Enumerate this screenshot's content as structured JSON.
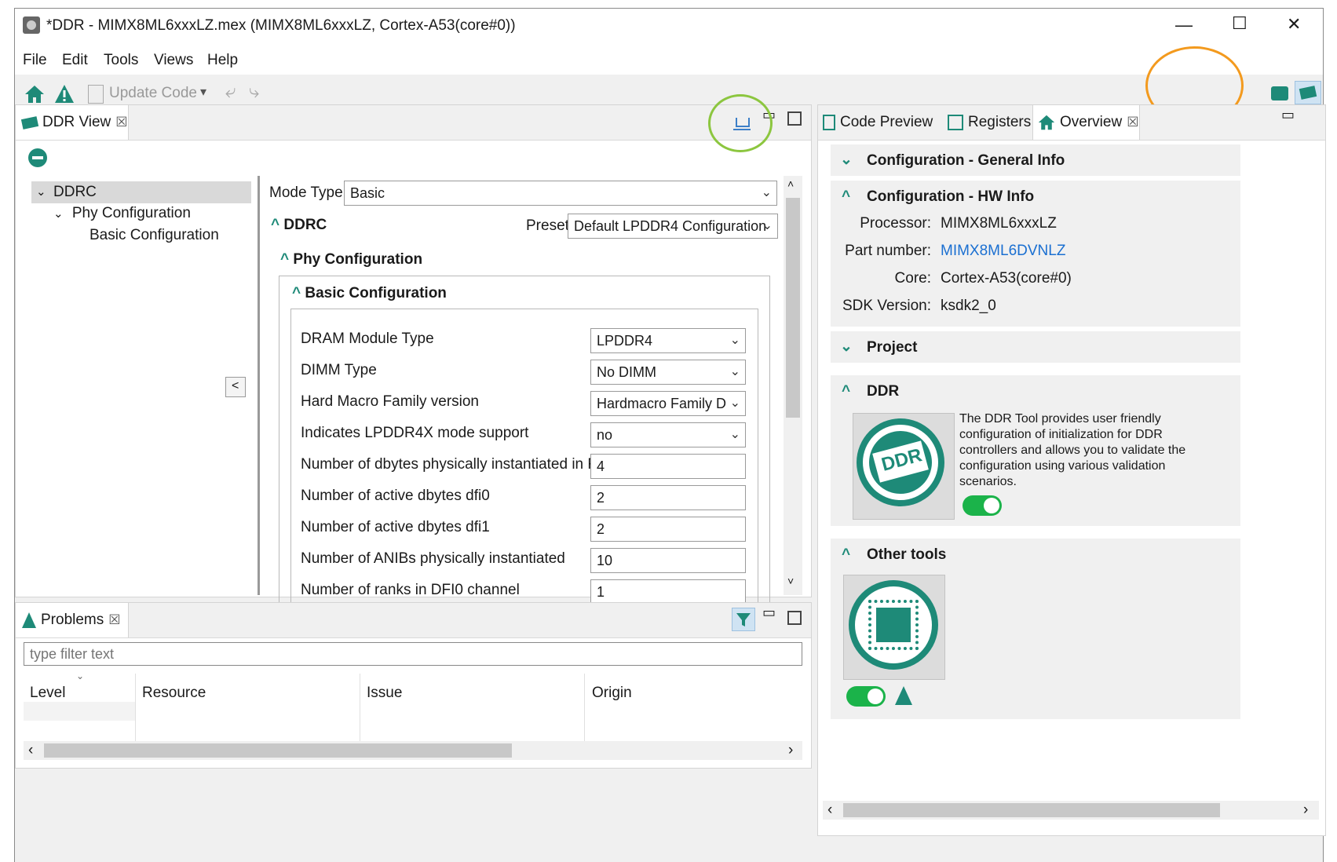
{
  "window": {
    "title": "*DDR - MIMX8ML6xxxLZ.mex (MIMX8ML6xxxLZ, Cortex-A53(core#0))",
    "minimize": "—",
    "maximize": "☐",
    "close": "✕"
  },
  "menu": [
    "File",
    "Edit",
    "Tools",
    "Views",
    "Help"
  ],
  "toolbar": {
    "update_code": "Update Code"
  },
  "ddr_view": {
    "tab_label": "DDR View",
    "tree": {
      "root": "DDRC",
      "child": "Phy Configuration",
      "leaf": "Basic Configuration"
    },
    "collapse_button": "<",
    "mode_type_label": "Mode Type:",
    "mode_type_value": "Basic",
    "ddrc_section": "DDRC",
    "preset_label": "Preset",
    "preset_value": "Default LPDDR4 Configuration",
    "phy_section": "Phy Configuration",
    "basic_section": "Basic Configuration",
    "rows": [
      {
        "label": "DRAM Module Type",
        "value": "LPDDR4",
        "combo": true
      },
      {
        "label": "DIMM Type",
        "value": "No DIMM",
        "combo": true
      },
      {
        "label": "Hard Macro Family version",
        "value": "Hardmacro Family D",
        "combo": true
      },
      {
        "label": "Indicates LPDDR4X mode support",
        "value": "no",
        "combo": true
      },
      {
        "label": "Number of dbytes physically instantiated in RTL",
        "value": "4",
        "combo": false
      },
      {
        "label": "Number of active dbytes dfi0",
        "value": "2",
        "combo": false
      },
      {
        "label": "Number of active dbytes dfi1",
        "value": "2",
        "combo": false
      },
      {
        "label": "Number of ANIBs physically instantiated",
        "value": "10",
        "combo": false
      },
      {
        "label": "Number of ranks in DFI0 channel",
        "value": "1",
        "combo": false
      }
    ]
  },
  "problems": {
    "tab_label": "Problems",
    "filter_placeholder": "type filter text",
    "columns": [
      "Level",
      "Resource",
      "Issue",
      "Origin"
    ]
  },
  "right_tabs": {
    "code_preview": "Code Preview",
    "registers": "Registers",
    "overview": "Overview"
  },
  "overview": {
    "general_info": "Configuration - General Info",
    "hw_info": "Configuration - HW Info",
    "hw_rows": [
      {
        "label": "Processor:",
        "value": "MIMX8ML6xxxLZ",
        "link": false
      },
      {
        "label": "Part number:",
        "value": "MIMX8ML6DVNLZ",
        "link": true
      },
      {
        "label": "Core:",
        "value": "Cortex-A53(core#0)",
        "link": false
      },
      {
        "label": "SDK Version:",
        "value": "ksdk2_0",
        "link": false
      }
    ],
    "project": "Project",
    "ddr": "DDR",
    "ddr_logo_text": "DDR",
    "ddr_description": "The DDR Tool provides user friendly configuration of initialization for DDR controllers and allows you to validate the configuration using various validation scenarios.",
    "other_tools": "Other tools"
  },
  "colors": {
    "accent_teal": "#1e8a78",
    "link_blue": "#1a6fd1",
    "toggle_green": "#1bb34a",
    "highlight_green": "#8cc63f",
    "highlight_orange": "#f39a1e"
  }
}
